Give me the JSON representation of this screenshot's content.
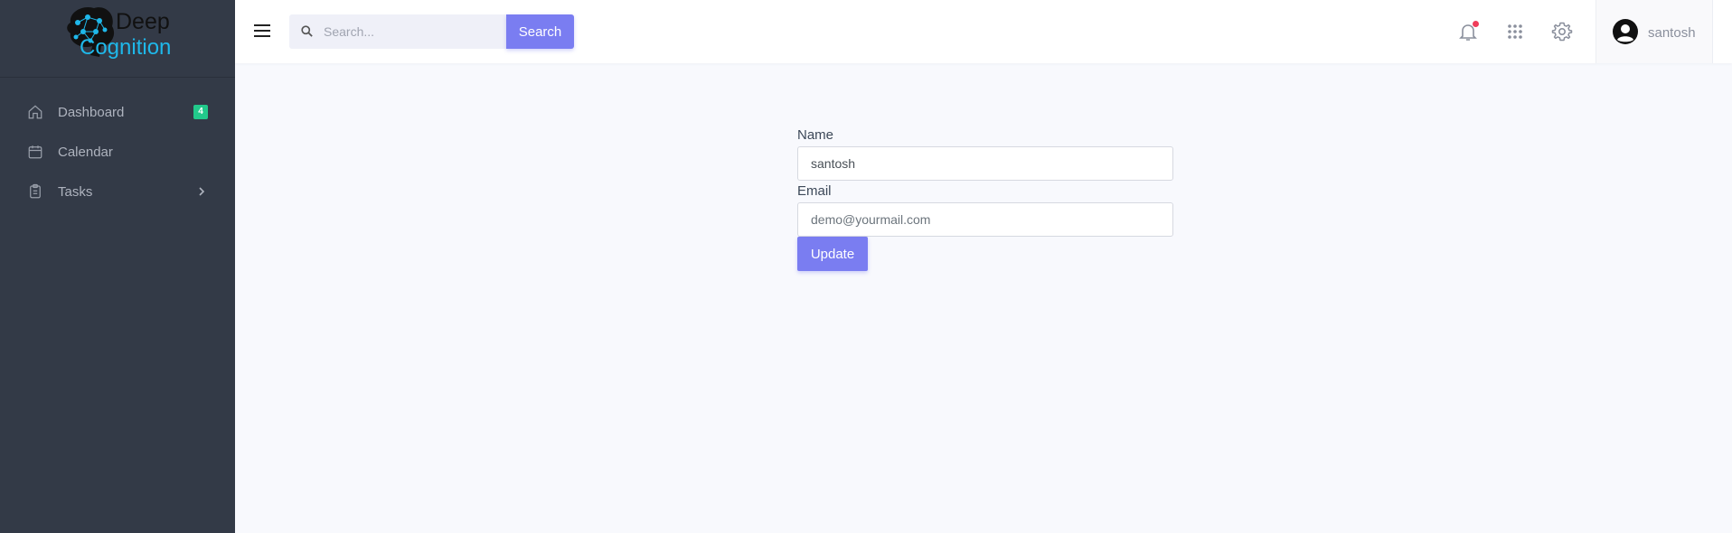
{
  "brand": {
    "line1": "Deep",
    "line2": "Cognition"
  },
  "sidebar": {
    "items": [
      {
        "label": "Dashboard",
        "icon": "home-icon",
        "badge": "4"
      },
      {
        "label": "Calendar",
        "icon": "calendar-icon"
      },
      {
        "label": "Tasks",
        "icon": "clipboard-icon",
        "has_submenu": true
      }
    ]
  },
  "topbar": {
    "search_placeholder": "Search...",
    "search_button": "Search",
    "notification_icon": "bell-icon",
    "apps_icon": "grid-icon",
    "settings_icon": "gear-icon",
    "user": {
      "name": "santosh",
      "avatar_icon": "user-avatar-icon"
    }
  },
  "form": {
    "name_label": "Name",
    "name_value": "santosh",
    "email_label": "Email",
    "email_placeholder": "demo@yourmail.com",
    "email_value": "",
    "submit_label": "Update"
  },
  "colors": {
    "sidebar_bg": "#333a47",
    "accent": "#7a7df1",
    "badge": "#22c98b",
    "notification_dot": "#ef3d5a",
    "brand_cyan": "#1fb8ea"
  }
}
